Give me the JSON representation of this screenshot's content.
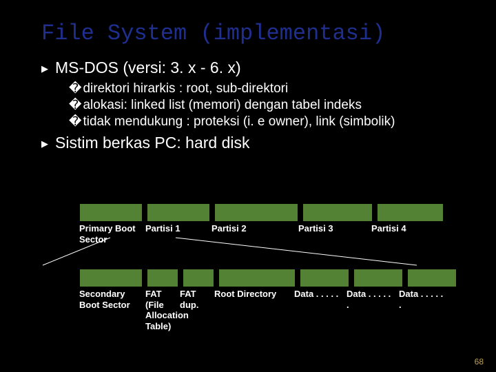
{
  "title": "File System (implementasi)",
  "bullets": {
    "b1a": "MS-DOS (versi: 3. x - 6. x)",
    "b2a": "direktori hirarkis : root, sub-direktori",
    "b2b": "alokasi: linked list (memori) dengan tabel indeks",
    "b2c": "tidak mendukung : proteksi (i. e owner), link (simbolik)",
    "b1b": "Sistim berkas PC: hard disk"
  },
  "top_labels": {
    "c0": "Primary Boot Sector",
    "c1": "Partisi 1",
    "c2": "Partisi 2",
    "c3": "Partisi 3",
    "c4": "Partisi 4"
  },
  "bot_labels": {
    "c0": "Secondary Boot Sector",
    "c1": "FAT (File Allocation Table)",
    "c2": "FAT dup.",
    "c3": "Root Directory",
    "c4": "Data  . . . . .",
    "c5": "Data  . . . . . .",
    "c6": "Data  . . . . . ."
  },
  "pagenum": "68",
  "colors": {
    "cell": "#548235",
    "title": "#1f2f8f"
  }
}
